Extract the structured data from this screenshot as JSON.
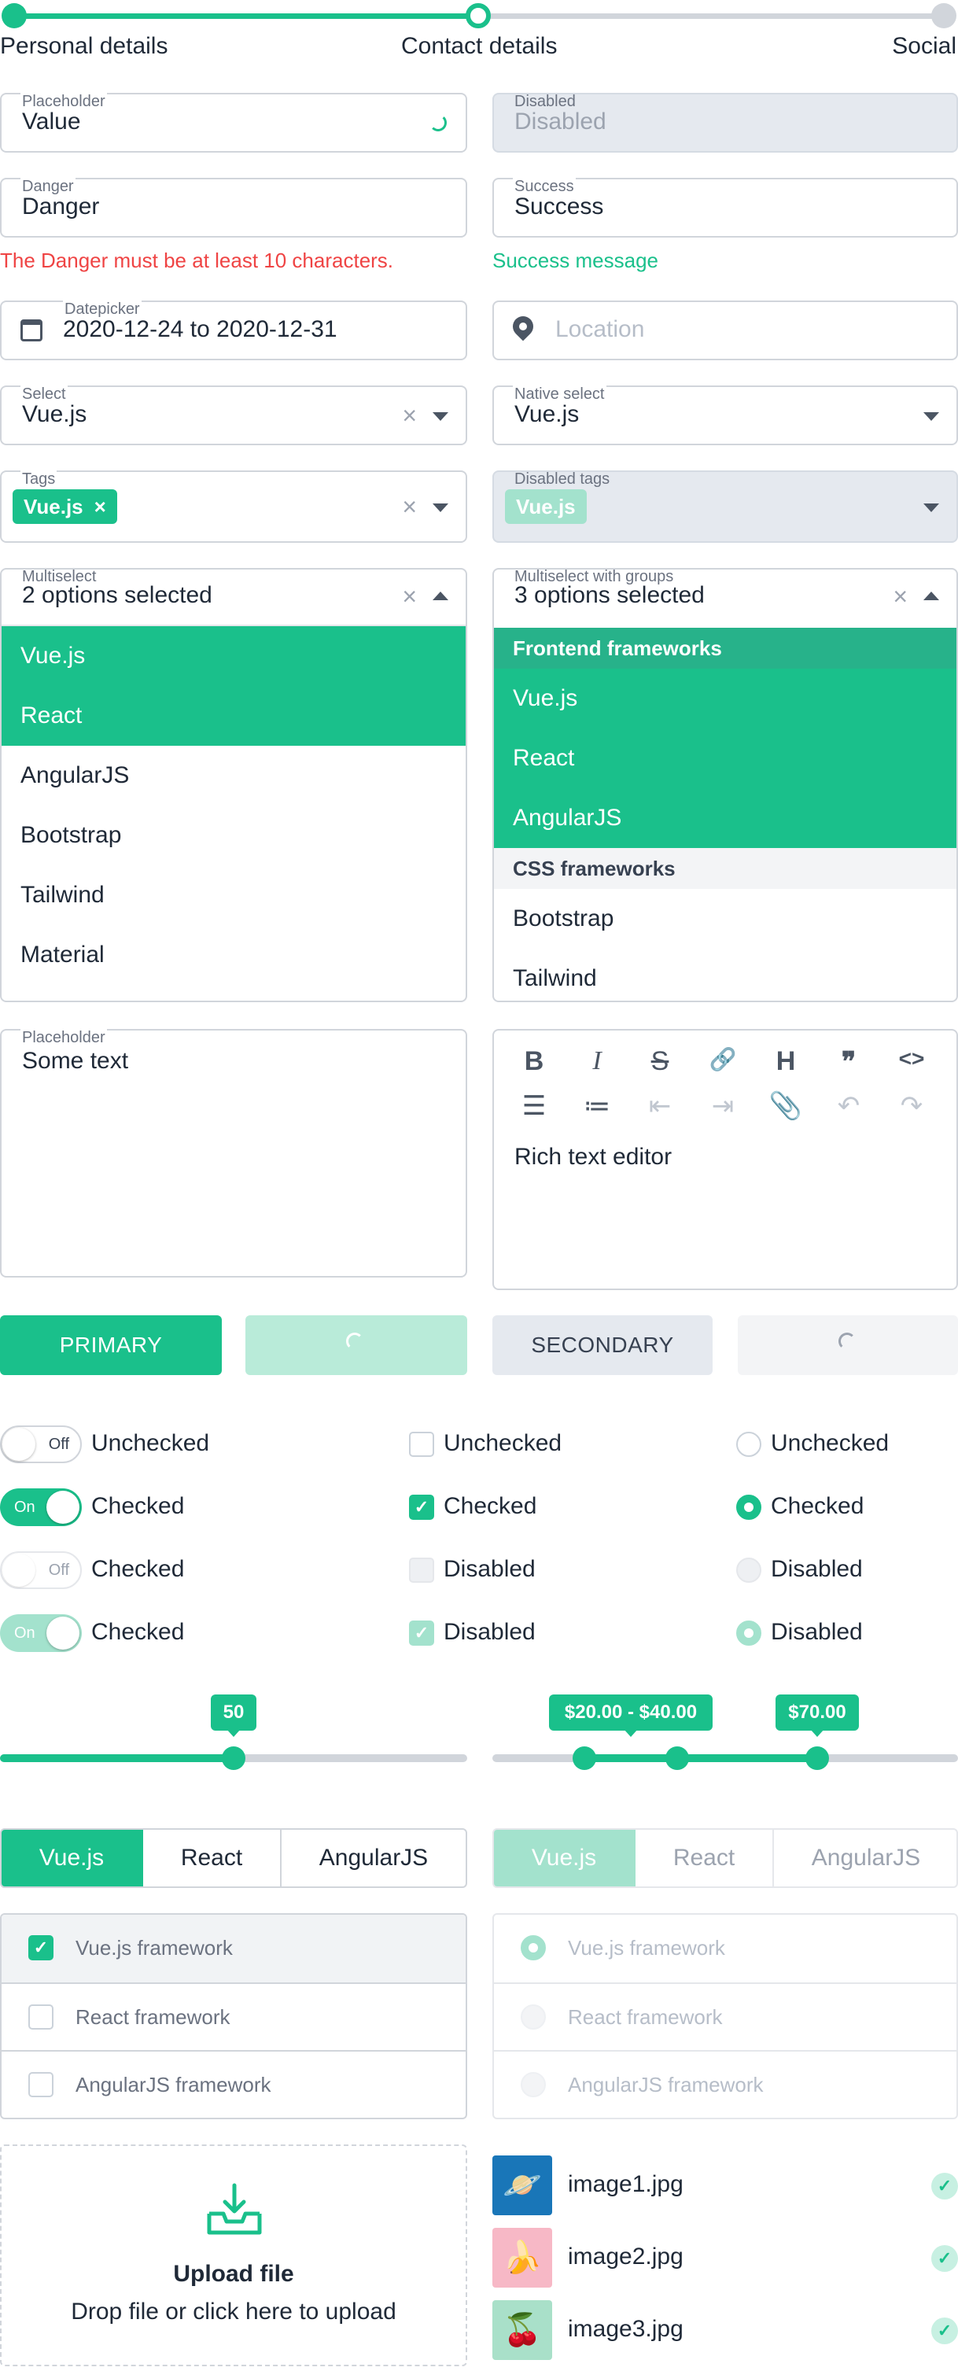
{
  "colors": {
    "accent": "#1ac08b",
    "danger": "#ef4444",
    "muted": "#d1d5db",
    "disabled_bg": "#e5e9ef"
  },
  "stepper": {
    "steps": [
      "Personal details",
      "Contact details",
      "Social"
    ],
    "current": 2
  },
  "fields": {
    "placeholder": {
      "label": "Placeholder",
      "value": "Value"
    },
    "disabled": {
      "label": "Disabled",
      "value": "Disabled"
    },
    "danger": {
      "label": "Danger",
      "value": "Danger",
      "message": "The Danger must be at least 10 characters."
    },
    "success": {
      "label": "Success",
      "value": "Success",
      "message": "Success message"
    },
    "datepicker": {
      "label": "Datepicker",
      "value": "2020-12-24 to 2020-12-31",
      "icon": "calendar-icon"
    },
    "location": {
      "placeholder": "Location",
      "icon": "map-pin-icon"
    },
    "select": {
      "label": "Select",
      "value": "Vue.js"
    },
    "native_select": {
      "label": "Native select",
      "value": "Vue.js"
    },
    "tags": {
      "label": "Tags",
      "tag": "Vue.js"
    },
    "disabled_tags": {
      "label": "Disabled tags",
      "tag": "Vue.js"
    }
  },
  "multiselect": {
    "label": "Multiselect",
    "summary": "2 options selected",
    "options": [
      "Vue.js",
      "React",
      "AngularJS",
      "Bootstrap",
      "Tailwind",
      "Material"
    ],
    "selected": [
      "Vue.js",
      "React"
    ]
  },
  "multiselect_groups": {
    "label": "Multiselect with groups",
    "summary": "3 options selected",
    "groups": [
      {
        "name": "Frontend frameworks",
        "options": [
          "Vue.js",
          "React",
          "AngularJS"
        ]
      },
      {
        "name": "CSS frameworks",
        "options": [
          "Bootstrap",
          "Tailwind"
        ]
      }
    ]
  },
  "textarea": {
    "label": "Placeholder",
    "value": "Some text"
  },
  "editor": {
    "content": "Rich text editor",
    "toolbar": [
      "bold-icon",
      "italic-icon",
      "strikethrough-icon",
      "link-icon",
      "heading-icon",
      "quote-icon",
      "code-icon",
      "bullet-list-icon",
      "numbered-list-icon",
      "outdent-icon",
      "indent-icon",
      "attachment-icon",
      "undo-icon",
      "redo-icon"
    ]
  },
  "buttons": {
    "primary": "PRIMARY",
    "secondary": "SECONDARY"
  },
  "toggles": [
    {
      "state": "Off",
      "label": "Unchecked"
    },
    {
      "state": "On",
      "label": "Checked"
    },
    {
      "state": "Off",
      "label": "Checked"
    },
    {
      "state": "On",
      "label": "Checked"
    }
  ],
  "checkboxes": [
    "Unchecked",
    "Checked",
    "Disabled",
    "Disabled"
  ],
  "radios": [
    "Unchecked",
    "Checked",
    "Disabled",
    "Disabled"
  ],
  "sliders": {
    "single": {
      "value": 50,
      "label": "50"
    },
    "range": {
      "label": "$20.00 - $40.00",
      "max_label": "$70.00",
      "values": [
        20,
        40,
        70
      ]
    }
  },
  "segmented": {
    "options": [
      "Vue.js",
      "React",
      "AngularJS"
    ],
    "selected": "Vue.js"
  },
  "checkbox_list": [
    "Vue.js framework",
    "React framework",
    "AngularJS framework"
  ],
  "radio_list": [
    "Vue.js framework",
    "React framework",
    "AngularJS framework"
  ],
  "upload": {
    "title": "Upload file",
    "subtitle": "Drop file or click here to upload"
  },
  "files": [
    {
      "name": "image1.jpg"
    },
    {
      "name": "image2.jpg"
    },
    {
      "name": "image3.jpg"
    }
  ]
}
